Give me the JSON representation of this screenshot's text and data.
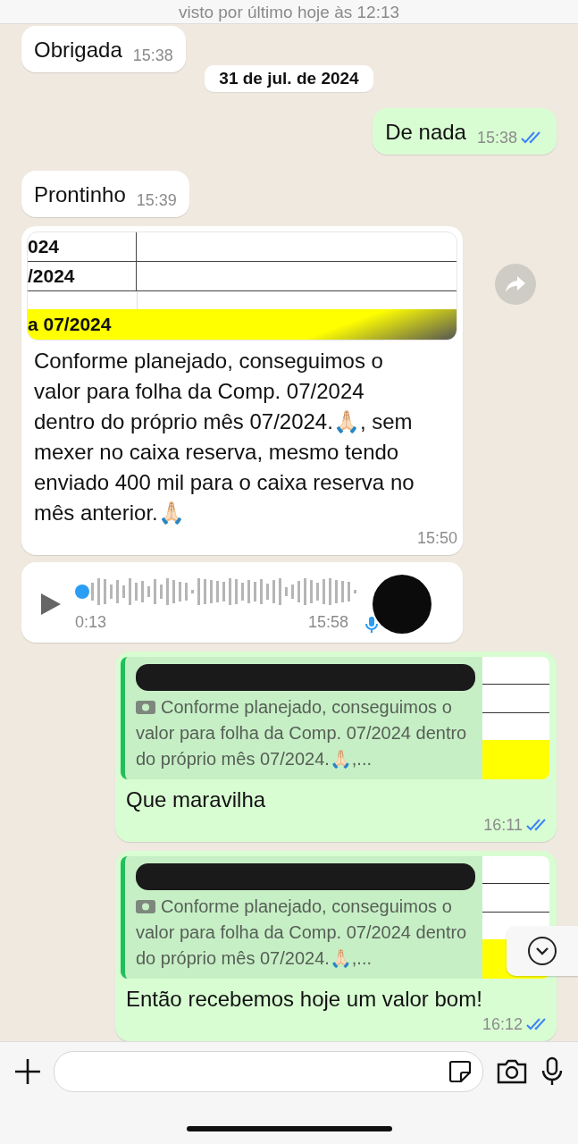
{
  "header": {
    "status": "visto por último hoje às 12:13"
  },
  "messages": [
    {
      "kind": "text",
      "outgoing": false,
      "text": "Obrigada",
      "time": "15:38"
    },
    {
      "kind": "date",
      "text": "31 de jul. de 2024"
    },
    {
      "kind": "text",
      "outgoing": true,
      "text": "De nada",
      "time": "15:38",
      "read": true
    },
    {
      "kind": "text",
      "outgoing": false,
      "text": "Prontinho",
      "time": "15:39"
    },
    {
      "kind": "image",
      "outgoing": false,
      "image_rows": [
        "024",
        "/2024"
      ],
      "image_highlight": "a 07/2024",
      "text": "Conforme planejado, conseguimos o valor para folha da Comp. 07/2024 dentro do próprio mês 07/2024.🙏🏻, sem mexer no caixa reserva, mesmo tendo enviado 400 mil para o caixa reserva no mês anterior.🙏🏻",
      "time": "15:50"
    },
    {
      "kind": "audio",
      "outgoing": false,
      "duration": "0:13",
      "time": "15:58"
    },
    {
      "kind": "reply",
      "outgoing": true,
      "quote": "Conforme planejado, conseguimos o valor para folha da Comp. 07/2024 dentro do próprio mês 07/2024.🙏🏻,...",
      "text": "Que maravilha",
      "time": "16:11",
      "read": true
    },
    {
      "kind": "reply",
      "outgoing": true,
      "quote": "Conforme planejado, conseguimos o valor para folha da Comp. 07/2024 dentro do próprio mês 07/2024.🙏🏻,...",
      "text": "Então recebemos hoje um valor bom!",
      "time": "16:12",
      "read": true
    }
  ]
}
